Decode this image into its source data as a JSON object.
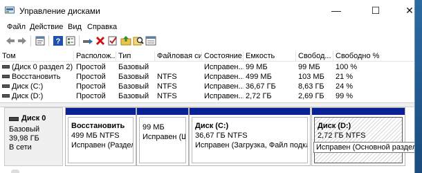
{
  "window": {
    "title": "Управление дисками"
  },
  "titlebar": {
    "min": "—",
    "max": "☐",
    "close": "✕"
  },
  "menu": [
    "Файл",
    "Действие",
    "Вид",
    "Справка"
  ],
  "toolbar": {
    "icons": [
      "back-icon",
      "forward-icon",
      "properties-icon",
      "help-icon",
      "connect-icon",
      "delete-icon",
      "check-icon",
      "folder-up-icon",
      "search-icon",
      "view-icon"
    ]
  },
  "table": {
    "headers": [
      "Том",
      "Располож...",
      "Тип",
      "Файловая сист...",
      "Состояние",
      "Емкость",
      "Свобод...",
      "Свободно %"
    ],
    "rows": [
      [
        "(Диск 0 раздел 2)",
        "Простой",
        "Базовый",
        "",
        "Исправен...",
        "99 МБ",
        "99 МБ",
        "100 %"
      ],
      [
        "Восстановить",
        "Простой",
        "Базовый",
        "NTFS",
        "Исправен...",
        "499 МБ",
        "103 МБ",
        "21 %"
      ],
      [
        "Диск (C:)",
        "Простой",
        "Базовый",
        "NTFS",
        "Исправен...",
        "36,67 ГБ",
        "8,63 ГБ",
        "24 %"
      ],
      [
        "Диск (D:)",
        "Простой",
        "Базовый",
        "NTFS",
        "Исправен...",
        "2,72 ГБ",
        "2,69 ГБ",
        "99 %"
      ]
    ]
  },
  "disk": {
    "name": "Диск 0",
    "type": "Базовый",
    "size": "39,98 ГБ",
    "status": "В сети"
  },
  "partitions": [
    {
      "title": "Восстановить",
      "line1": "499 МБ NTFS",
      "line2": "Исправен (Раздел из"
    },
    {
      "title": "",
      "line1": "99 МБ",
      "line2": "Исправен (Ши"
    },
    {
      "title": "Диск  (C:)",
      "line1": "36,67 ГБ NTFS",
      "line2": "Исправен (Загрузка, Файл подкачки, А"
    },
    {
      "title": "Диск  (D:)",
      "line1": "2,72 ГБ NTFS",
      "line2": ""
    }
  ],
  "tooltip": "Исправен (Основной раздел)",
  "colors": {
    "primary_partition_bar": "#0a2196"
  }
}
